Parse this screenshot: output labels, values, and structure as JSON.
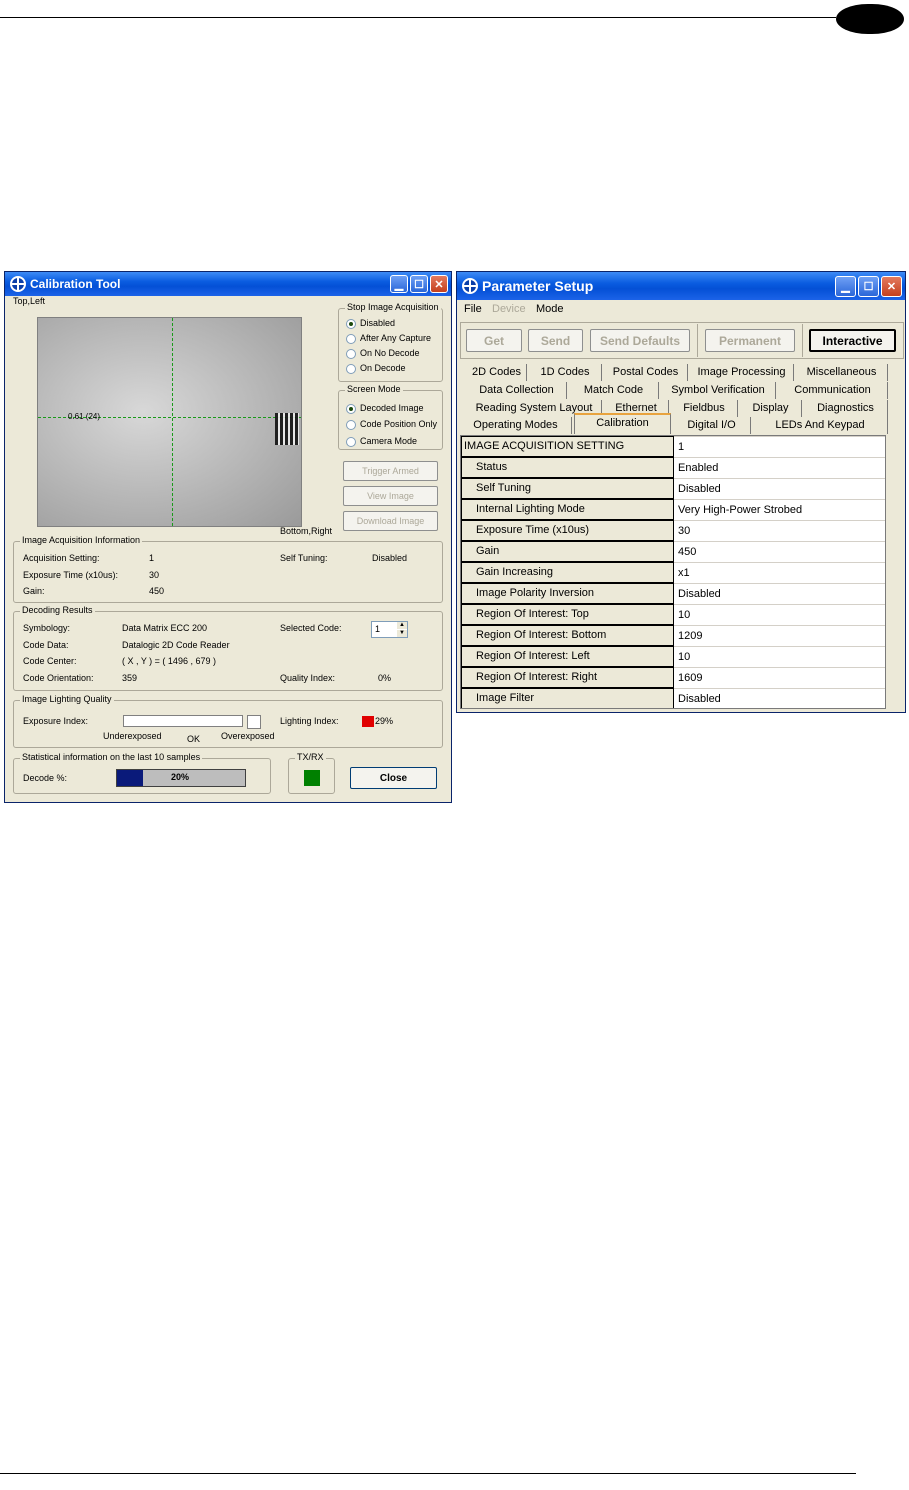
{
  "calibration_tool": {
    "title": "Calibration Tool",
    "top_left_label": "Top,Left",
    "bottom_right_label": "Bottom,Right",
    "crosshair_label": "0.61 (24)",
    "stop_acquisition": {
      "title": "Stop Image Acquisition",
      "options": [
        "Disabled",
        "After Any Capture",
        "On No Decode",
        "On Decode"
      ],
      "selected": "Disabled"
    },
    "screen_mode": {
      "title": "Screen Mode",
      "options": [
        "Decoded Image",
        "Code Position Only",
        "Camera Mode"
      ],
      "selected": "Decoded Image"
    },
    "buttons": {
      "trigger": "Trigger Armed",
      "view": "View Image",
      "download": "Download Image",
      "close": "Close"
    },
    "acq_info": {
      "title": "Image Acquisition Information",
      "setting_label": "Acquisition Setting:",
      "setting_value": "1",
      "exposure_label": "Exposure Time (x10us):",
      "exposure_value": "30",
      "gain_label": "Gain:",
      "gain_value": "450",
      "tuning_label": "Self Tuning:",
      "tuning_value": "Disabled"
    },
    "decoding": {
      "title": "Decoding Results",
      "symbology_label": "Symbology:",
      "symbology_value": "Data Matrix ECC 200",
      "data_label": "Code Data:",
      "data_value": "Datalogic 2D Code Reader",
      "center_label": "Code Center:",
      "center_value": "( X , Y ) = ( 1496 , 679 )",
      "orientation_label": "Code Orientation:",
      "orientation_value": "359",
      "selected_label": "Selected Code:",
      "selected_value": "1",
      "quality_label": "Quality Index:",
      "quality_value": "0%"
    },
    "lighting": {
      "title": "Image Lighting Quality",
      "exposure_label": "Exposure Index:",
      "under": "Underexposed",
      "ok": "OK",
      "over": "Overexposed",
      "lighting_label": "Lighting Index:",
      "lighting_value": "29%",
      "lighting_color": "#e00000"
    },
    "stats": {
      "title": "Statistical information on the last 10 samples",
      "decode_label": "Decode %:",
      "decode_value": "20%",
      "decode_fraction": 0.2
    },
    "txrx": {
      "title": "TX/RX",
      "color": "#008000"
    }
  },
  "parameter_setup": {
    "title": "Parameter Setup",
    "menu": [
      "File",
      "Device",
      "Mode"
    ],
    "toolbar": {
      "get": "Get",
      "send": "Send",
      "send_defaults": "Send Defaults",
      "permanent": "Permanent",
      "interactive": "Interactive"
    },
    "tabs_row1": [
      "2D Codes",
      "1D Codes",
      "Postal Codes",
      "Image Processing",
      "Miscellaneous"
    ],
    "tabs_row2": [
      "Data Collection",
      "Match Code",
      "Symbol Verification",
      "Communication"
    ],
    "tabs_row3": [
      "Reading System Layout",
      "Ethernet",
      "Fieldbus",
      "Display",
      "Diagnostics"
    ],
    "tabs_row4": [
      "Operating Modes",
      "Calibration",
      "Digital I/O",
      "LEDs And Keypad"
    ],
    "active_tab": "Calibration",
    "rows": [
      {
        "key": "IMAGE ACQUISITION SETTING",
        "value": "1"
      },
      {
        "key": "Status",
        "value": "Enabled"
      },
      {
        "key": "Self Tuning",
        "value": "Disabled"
      },
      {
        "key": "Internal Lighting Mode",
        "value": "Very High-Power Strobed"
      },
      {
        "key": "Exposure Time (x10us)",
        "value": "30"
      },
      {
        "key": "Gain",
        "value": "450"
      },
      {
        "key": "Gain Increasing",
        "value": "x1"
      },
      {
        "key": "Image Polarity Inversion",
        "value": "Disabled"
      },
      {
        "key": "Region Of Interest: Top",
        "value": "10"
      },
      {
        "key": "Region Of Interest: Bottom",
        "value": "1209"
      },
      {
        "key": "Region Of Interest: Left",
        "value": "10"
      },
      {
        "key": "Region Of Interest: Right",
        "value": "1609"
      },
      {
        "key": "Image Filter",
        "value": "Disabled"
      }
    ]
  }
}
